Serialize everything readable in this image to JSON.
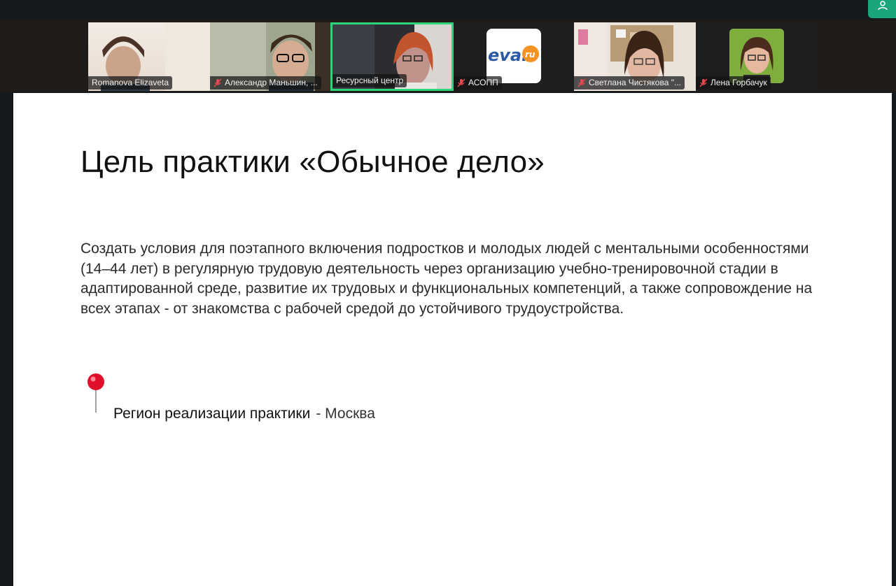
{
  "participants": [
    {
      "name": "Romanova Elizaveta",
      "muted": false,
      "active": false
    },
    {
      "name": "Александр Маньшин, ...",
      "muted": true,
      "active": false
    },
    {
      "name": "Ресурсный центр",
      "muted": false,
      "active": true
    },
    {
      "name": "АСОПП",
      "muted": true,
      "active": false,
      "avatar_text": "eval",
      "avatar_badge": "ru"
    },
    {
      "name": "Светлана Чистякова \"...",
      "muted": true,
      "active": false
    },
    {
      "name": "Лена Горбачук",
      "muted": true,
      "active": false
    }
  ],
  "slide": {
    "title": "Цель практики «Обычное дело»",
    "body": "Создать условия для поэтапного включения подростков и молодых людей с ментальными особенностями (14–44 лет) в регулярную трудовую деятельность через организацию учебно-тренировочной стадии в адаптированной среде, развитие их трудовых и функциональных компетенций, а также сопровождение на всех этапах - от знакомства с рабочей средой до устойчивого трудоустройства.",
    "region_label": "Регион реализации практики",
    "region_value": "- Москва"
  },
  "colors": {
    "active_border": "#2fd47a",
    "corner_button": "#1aa57a",
    "muted_icon": "#e5484d",
    "pin": "#e0102a"
  },
  "icons": {
    "corner": "person-icon",
    "mute": "mic-muted-icon",
    "slide_marker": "pushpin-icon"
  }
}
